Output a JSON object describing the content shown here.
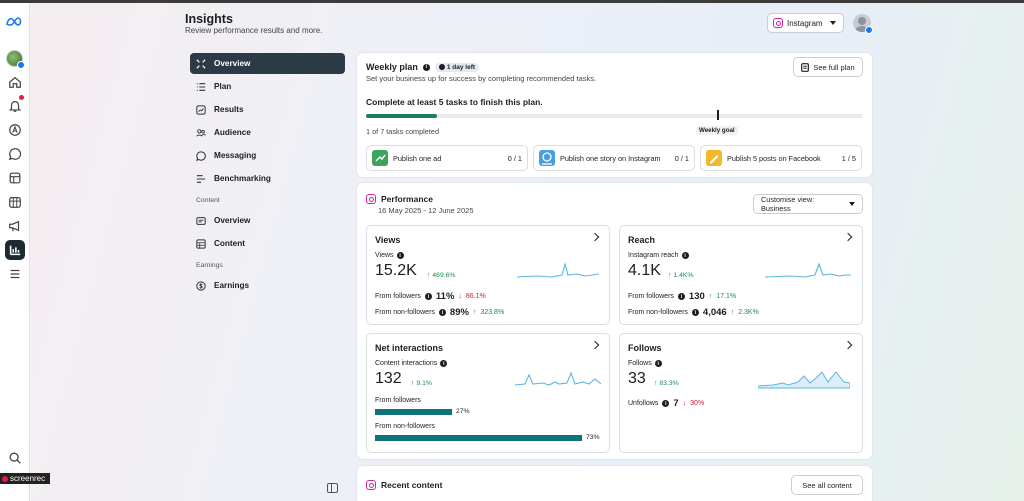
{
  "header": {
    "title": "Insights",
    "subtitle": "Review performance results and more."
  },
  "account_select": {
    "value": "Instagram"
  },
  "screenrec_label": "screenrec",
  "nav": {
    "items": [
      {
        "label": "Overview"
      },
      {
        "label": "Plan"
      },
      {
        "label": "Results"
      },
      {
        "label": "Audience"
      },
      {
        "label": "Messaging"
      },
      {
        "label": "Benchmarking"
      }
    ],
    "content_section": "Content",
    "content_items": [
      {
        "label": "Overview"
      },
      {
        "label": "Content"
      }
    ],
    "earnings_section": "Earnings",
    "earnings_items": [
      {
        "label": "Earnings"
      }
    ]
  },
  "weekly_plan": {
    "title": "Weekly plan",
    "badge": "1 day left",
    "subtitle": "Set your business up for success by completing recommended tasks.",
    "see_full_plan": "See full plan",
    "task_heading": "Complete at least 5 tasks to finish this plan.",
    "progress_fraction": 0.1428,
    "weekly_goal_label": "Weekly goal",
    "completed_text": "1 of 7 tasks completed",
    "tasks": [
      {
        "label": "Publish one ad",
        "count": "0 / 1"
      },
      {
        "label": "Publish one story on Instagram",
        "count": "0 / 1"
      },
      {
        "label": "Publish 5 posts on Facebook",
        "count": "1 / 5"
      }
    ]
  },
  "performance": {
    "title": "Performance",
    "date_range": "16 May 2025 - 12 June 2025",
    "customise_label": "Customise view: Business",
    "views": {
      "title": "Views",
      "label": "Views",
      "value": "15.2K",
      "change": "469.6%",
      "followers_label": "From followers",
      "followers_value": "11%",
      "followers_change": "86.1%",
      "nonfollowers_label": "From non-followers",
      "nonfollowers_value": "89%",
      "nonfollowers_change": "323.8%"
    },
    "reach": {
      "title": "Reach",
      "label": "Instagram reach",
      "value": "4.1K",
      "change": "1.4K%",
      "followers_label": "From followers",
      "followers_value": "130",
      "followers_change": "17.1%",
      "nonfollowers_label": "From non-followers",
      "nonfollowers_value": "4,046",
      "nonfollowers_change": "2.3K%"
    },
    "net_interactions": {
      "title": "Net interactions",
      "label": "Content interactions",
      "value": "132",
      "change": "9.1%",
      "followers_label": "From followers",
      "followers_pct": "27%",
      "followers_fraction": 0.27,
      "nonfollowers_label": "From non-followers",
      "nonfollowers_pct": "73%",
      "nonfollowers_fraction": 0.73
    },
    "follows": {
      "title": "Follows",
      "label": "Follows",
      "value": "33",
      "change": "83.3%",
      "unfollows_label": "Unfollows",
      "unfollows_value": "7",
      "unfollows_change": "30%"
    }
  },
  "recent_content": {
    "title": "Recent content",
    "see_all": "See all content"
  },
  "colors": {
    "accent_green": "#1a8a4e",
    "decline_red": "#c8202e",
    "bar_teal": "#0e737a",
    "spark_blue": "#5bb5e0"
  }
}
